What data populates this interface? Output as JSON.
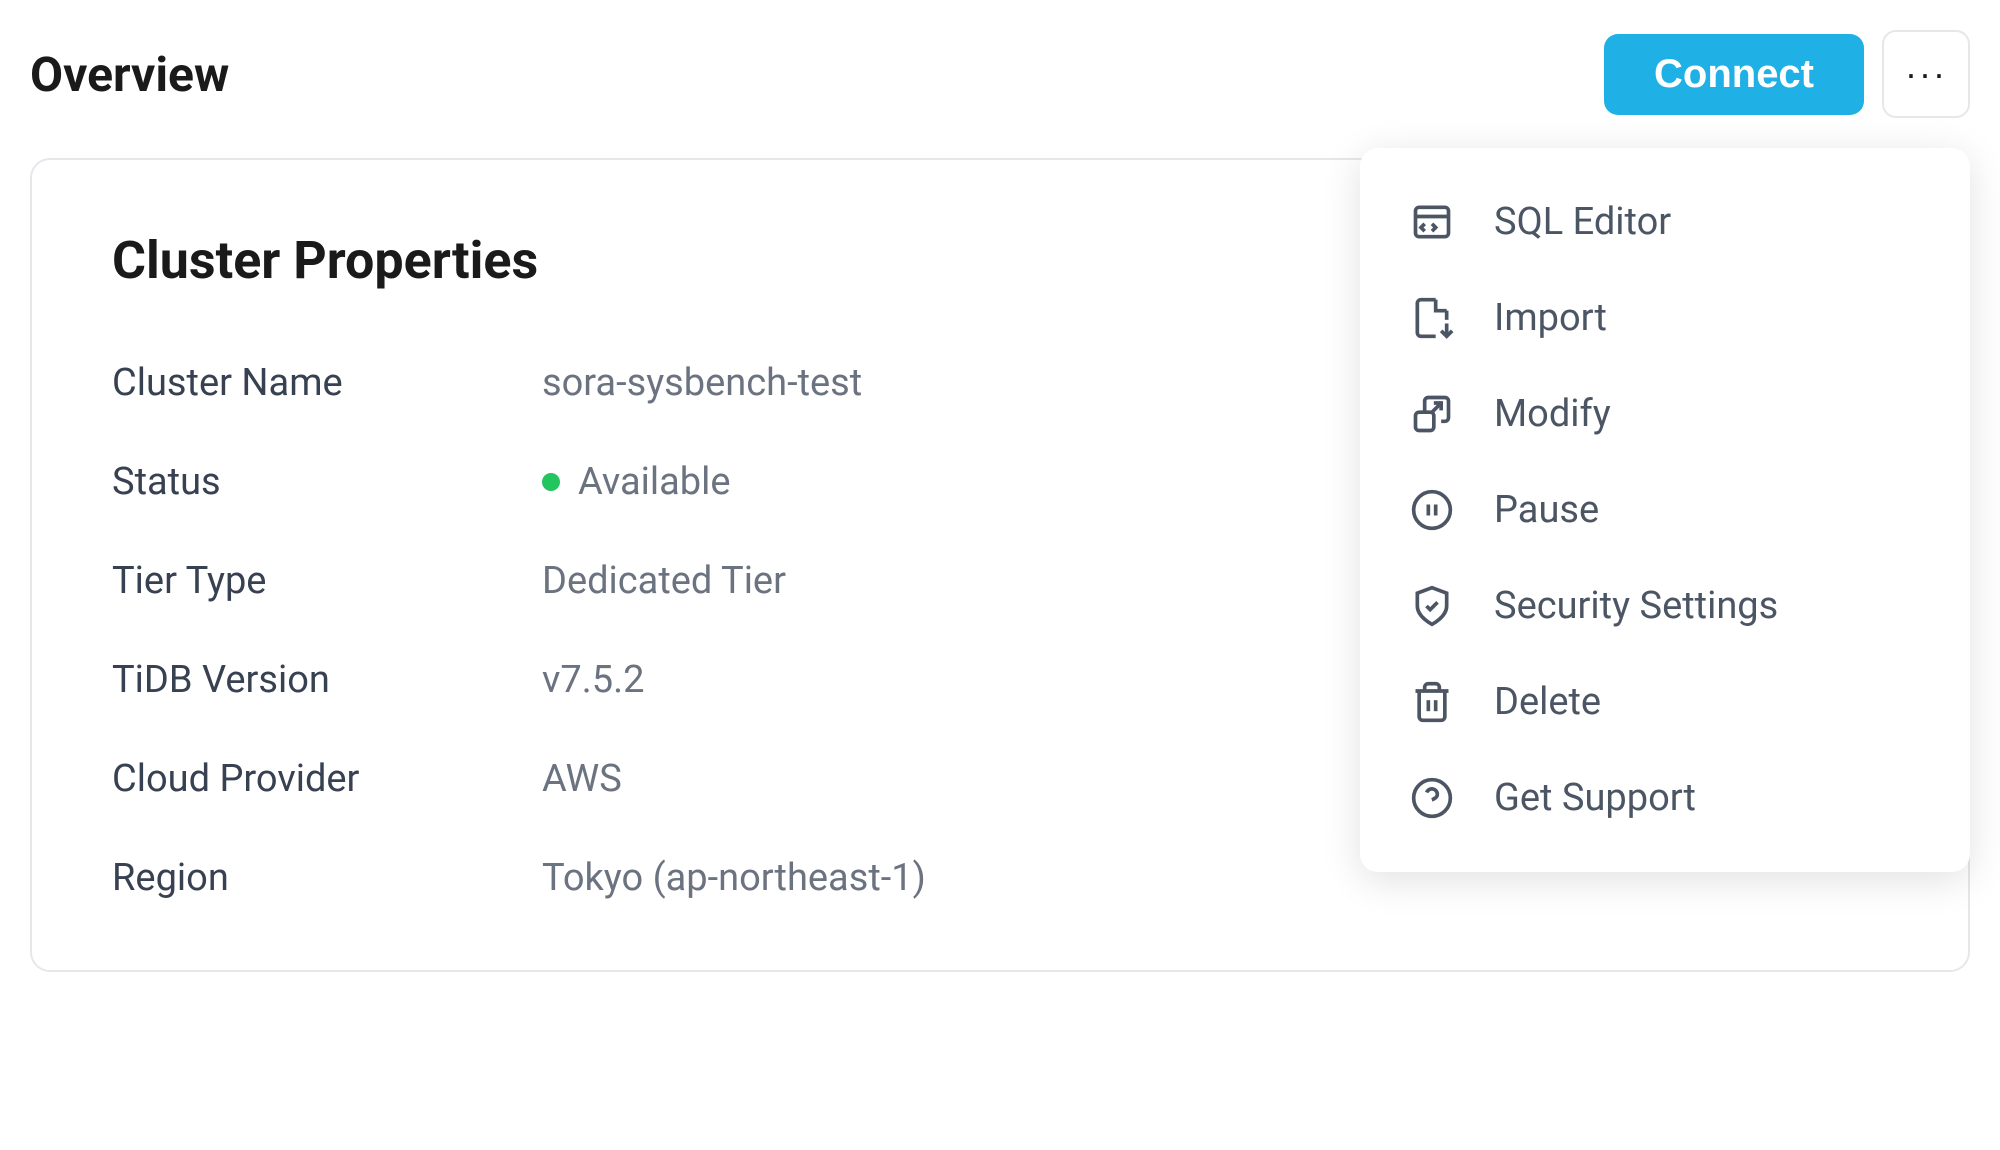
{
  "page": {
    "title": "Overview"
  },
  "header": {
    "connect_label": "Connect",
    "more_label": "···"
  },
  "card": {
    "title": "Cluster Properties"
  },
  "properties": {
    "cluster_name": {
      "label": "Cluster Name",
      "value": "sora-sysbench-test"
    },
    "status": {
      "label": "Status",
      "value": "Available"
    },
    "tier_type": {
      "label": "Tier Type",
      "value": "Dedicated Tier"
    },
    "tidb_version": {
      "label": "TiDB Version",
      "value": "v7.5.2"
    },
    "cloud_provider": {
      "label": "Cloud Provider",
      "value": "AWS"
    },
    "region": {
      "label": "Region",
      "value": "Tokyo (ap-northeast-1)"
    }
  },
  "menu": {
    "sql_editor": "SQL Editor",
    "import": "Import",
    "modify": "Modify",
    "pause": "Pause",
    "security_settings": "Security Settings",
    "delete": "Delete",
    "get_support": "Get Support"
  }
}
